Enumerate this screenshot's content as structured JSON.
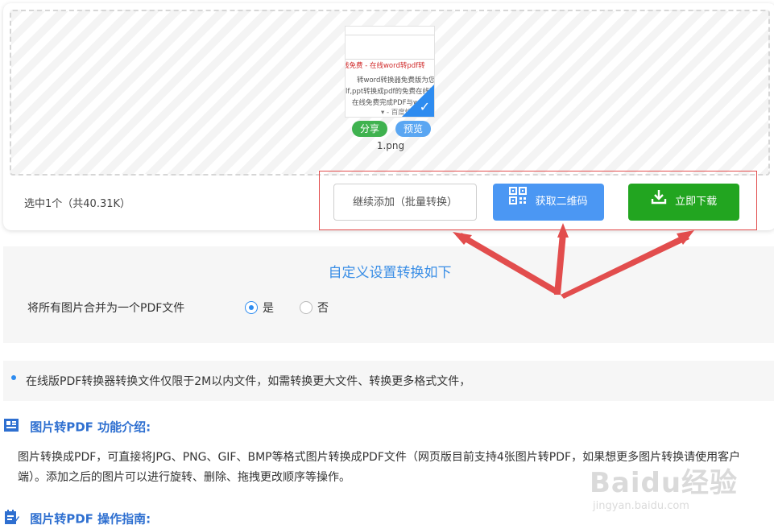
{
  "file": {
    "name": "1.png",
    "share_label": "分享",
    "preview_label": "预览",
    "thumbnail_lines": [
      "线免费 - 在线word转pdf转",
      "转word转换器免费版为您提",
      "lf,ppt转换成pdf的免费在线转",
      "在线免费完成PDF与word",
      "▾ - 百度快照"
    ]
  },
  "selection": {
    "info": "选中1个（共40.31K）"
  },
  "actions": {
    "continue_label": "继续添加（批量转换）",
    "qr_label": "获取二维码",
    "download_label": "立即下载"
  },
  "settings": {
    "title": "自定义设置转换如下",
    "merge_label": "将所有图片合并为一个PDF文件",
    "yes_label": "是",
    "no_label": "否",
    "selected": "是"
  },
  "notice": {
    "text": "在线版PDF转换器转换文件仅限于2M以内文件，如需转换更大文件、转换更多格式文件，"
  },
  "intro": {
    "title": "图片转PDF 功能介绍:",
    "text": "图片转换成PDF，可直接将JPG、PNG、GIF、BMP等格式图片转换成PDF文件（网页版目前支持4张图片转PDF，如果想更多图片转换请使用客户端）。添加之后的图片可以进行旋转、删除、拖拽更改顺序等操作。"
  },
  "guide": {
    "title": "图片转PDF 操作指南:"
  },
  "watermark": {
    "main": "Baidu经验",
    "sub": "jingyan.baidu.com"
  },
  "colors": {
    "accent_blue": "#2e8cf0",
    "download_green": "#22a520",
    "qr_blue": "#4b97f3",
    "annotation_red": "#e24d4d"
  }
}
